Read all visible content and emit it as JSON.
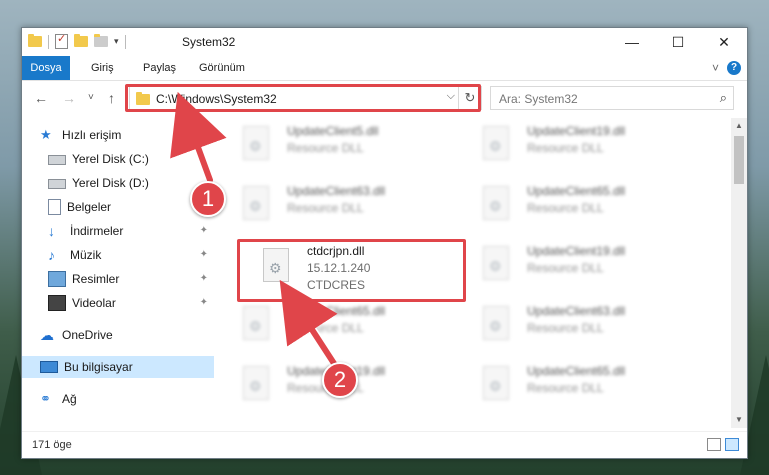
{
  "window": {
    "title": "System32",
    "minimize_glyph": "—",
    "maximize_glyph": "☐",
    "close_glyph": "✕"
  },
  "ribbon": {
    "tabs": [
      "Dosya",
      "Giriş",
      "Paylaş",
      "Görünüm"
    ],
    "expand_glyph": "˅",
    "help_glyph": "?"
  },
  "navigation": {
    "back_glyph": "←",
    "forward_glyph": "→",
    "recent_glyph": "˅",
    "up_glyph": "↑"
  },
  "address": {
    "path": "C:\\Windows\\System32",
    "dropdown_glyph": "⌵",
    "refresh_glyph": "↻"
  },
  "search": {
    "placeholder": "Ara: System32",
    "icon": "magnifier-icon"
  },
  "sidebar": {
    "items": [
      {
        "label": "Hızlı erişim",
        "icon": "star-icon"
      },
      {
        "label": "Yerel Disk (C:)",
        "icon": "drive-icon"
      },
      {
        "label": "Yerel Disk (D:)",
        "icon": "drive-icon"
      },
      {
        "label": "Belgeler",
        "icon": "document-icon"
      },
      {
        "label": "İndirmeler",
        "icon": "download-icon",
        "pinned": true
      },
      {
        "label": "Müzik",
        "icon": "music-icon",
        "pinned": true
      },
      {
        "label": "Resimler",
        "icon": "pictures-icon",
        "pinned": true
      },
      {
        "label": "Videolar",
        "icon": "videos-icon",
        "pinned": true
      },
      {
        "label": "OneDrive",
        "icon": "cloud-icon"
      },
      {
        "label": "Bu bilgisayar",
        "icon": "computer-icon",
        "selected": true
      },
      {
        "label": "Ağ",
        "icon": "network-icon"
      }
    ],
    "pin_glyph": "📌"
  },
  "files": [
    {
      "name": "UpdateClient5.dll",
      "desc": "Resource DLL",
      "blurred": true
    },
    {
      "name": "UpdateClient19.dll",
      "desc": "Resource DLL",
      "blurred": true
    },
    {
      "name": "UpdateClient63.dll",
      "desc": "Resource DLL",
      "blurred": true
    },
    {
      "name": "UpdateClient65.dll",
      "desc": "Resource DLL",
      "blurred": true
    },
    {
      "name": "ctdcrjpn.dll",
      "desc": "15.12.1.240",
      "desc2": "CTDCRES",
      "blurred": false
    },
    {
      "name": "UpdateClient19.dll",
      "desc": "Resource DLL",
      "blurred": true
    },
    {
      "name": "UpdateClient65.dll",
      "desc": "Resource DLL",
      "blurred": true
    },
    {
      "name": "UpdateClient63.dll",
      "desc": "Resource DLL",
      "blurred": true
    },
    {
      "name": "UpdateClient19.dll",
      "desc": "Resource DLL",
      "blurred": true
    },
    {
      "name": "UpdateClient65.dll",
      "desc": "Resource DLL",
      "blurred": true
    }
  ],
  "status": {
    "count": "171 öge"
  },
  "annotations": {
    "badge1": "1",
    "badge2": "2",
    "color": "#e0454a"
  }
}
